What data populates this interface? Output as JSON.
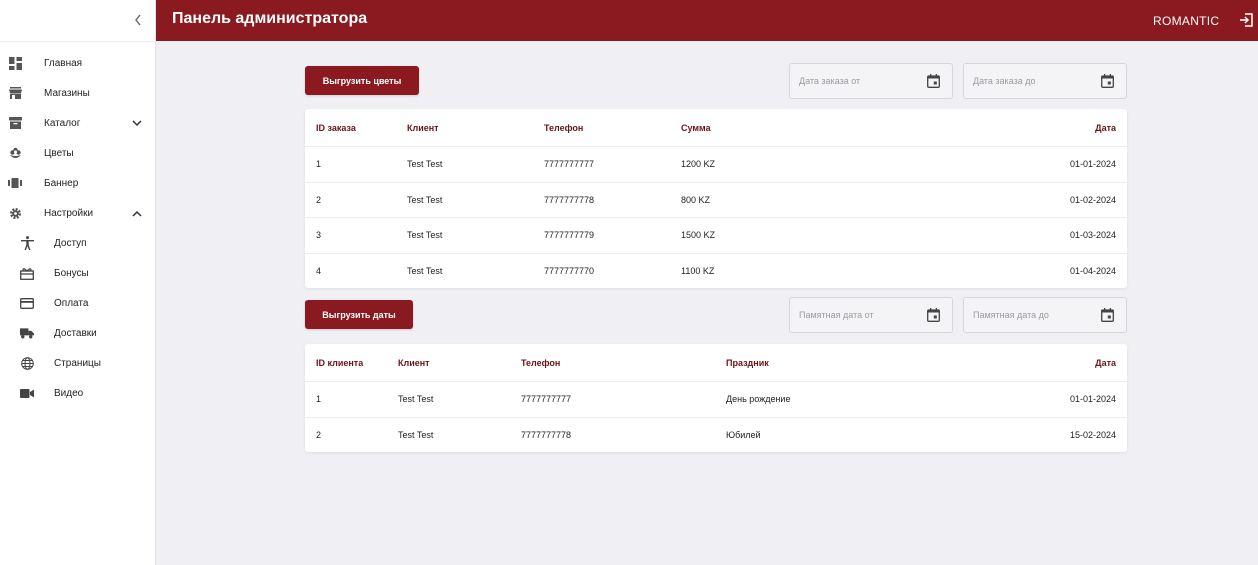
{
  "header": {
    "title": "Панель администратора",
    "brand": "ROMANTIC"
  },
  "sidebar": {
    "items": [
      {
        "label": "Главная",
        "icon": "dashboard-icon"
      },
      {
        "label": "Магазины",
        "icon": "store-icon"
      },
      {
        "label": "Каталог",
        "icon": "archive-icon"
      },
      {
        "label": "Цветы",
        "icon": "flower-icon"
      },
      {
        "label": "Баннер",
        "icon": "banner-icon"
      },
      {
        "label": "Настройки",
        "icon": "gear-icon"
      }
    ],
    "sub_items": [
      {
        "label": "Доступ",
        "icon": "accessibility-icon"
      },
      {
        "label": "Бонусы",
        "icon": "gift-icon"
      },
      {
        "label": "Оплата",
        "icon": "credit-card-icon"
      },
      {
        "label": "Доставки",
        "icon": "truck-icon"
      },
      {
        "label": "Страницы",
        "icon": "globe-icon"
      },
      {
        "label": "Видео",
        "icon": "video-icon"
      }
    ]
  },
  "orders": {
    "export_label": "Выгрузить цветы",
    "date_from_placeholder": "Дата заказа от",
    "date_to_placeholder": "Дата заказа до",
    "columns": [
      "ID заказа",
      "Клиент",
      "Телефон",
      "Сумма",
      "Дата"
    ],
    "rows": [
      [
        "1",
        "Test Test",
        "7777777777",
        "1200 KZ",
        "01-01-2024"
      ],
      [
        "2",
        "Test Test",
        "7777777778",
        "800 KZ",
        "01-02-2024"
      ],
      [
        "3",
        "Test Test",
        "7777777779",
        "1500 KZ",
        "01-03-2024"
      ],
      [
        "4",
        "Test Test",
        "7777777770",
        "1100 KZ",
        "01-04-2024"
      ]
    ]
  },
  "dates": {
    "export_label": "Выгрузить даты",
    "date_from_placeholder": "Памятная дата от",
    "date_to_placeholder": "Памятная дата до",
    "columns": [
      "ID клиента",
      "Клиент",
      "Телефон",
      "Праздник",
      "Дата"
    ],
    "rows": [
      [
        "1",
        "Test Test",
        "7777777777",
        "День рождение",
        "01-01-2024"
      ],
      [
        "2",
        "Test Test",
        "7777777778",
        "Юбилей",
        "15-02-2024"
      ]
    ]
  },
  "colors": {
    "primary": "#8b1a20",
    "header_text": "#6b1418",
    "background": "#f0f0f4"
  }
}
